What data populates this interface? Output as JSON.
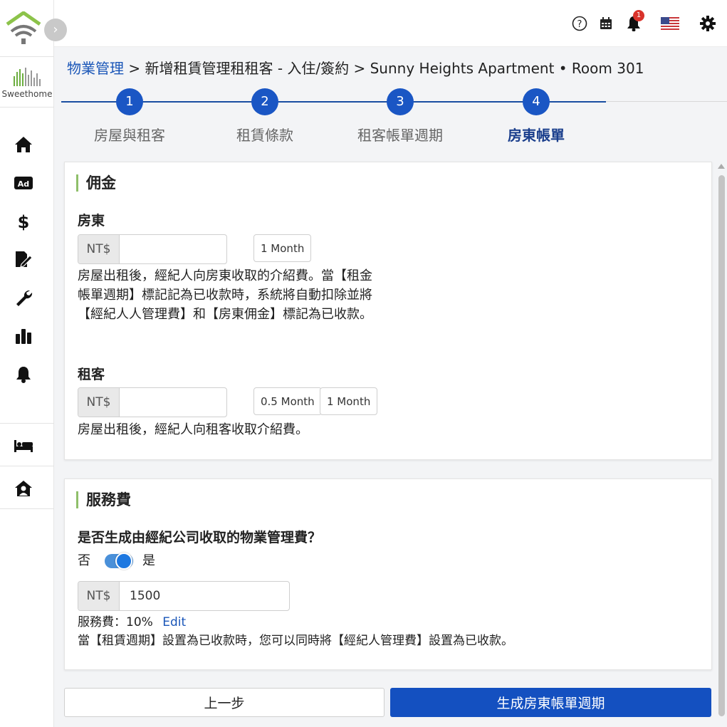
{
  "brand": {
    "name": "Sweethome"
  },
  "topbar": {
    "help_icon": "help-icon",
    "calendar_icon": "calendar-icon",
    "notification_count": "1",
    "language_icon": "us-flag-icon",
    "settings_icon": "gear-icon"
  },
  "sidebar": {
    "items": [
      {
        "icon": "home-icon"
      },
      {
        "icon": "ad-icon"
      },
      {
        "icon": "dollar-icon"
      },
      {
        "icon": "contract-edit-icon"
      },
      {
        "icon": "wrench-icon"
      },
      {
        "icon": "bar-chart-icon"
      },
      {
        "icon": "bell-icon"
      },
      {
        "icon": "bed-icon"
      },
      {
        "icon": "house-user-icon"
      }
    ]
  },
  "breadcrumb": {
    "root": "物業管理",
    "rest": " > 新增租賃管理租租客 - 入住/簽約 > Sunny Heights Apartment • Room 301"
  },
  "steps": [
    {
      "number": "1",
      "label": "房屋與租客"
    },
    {
      "number": "2",
      "label": "租賃條款"
    },
    {
      "number": "3",
      "label": "租客帳單週期"
    },
    {
      "number": "4",
      "label": "房東帳單"
    }
  ],
  "commission": {
    "title": "佣金",
    "landlord": {
      "label": "房東",
      "prefix": "NT$",
      "value": "",
      "chips": [
        "1 Month"
      ],
      "description": "房屋出租後，經紀人向房東收取的介紹費。當【租金帳單週期】標記記為已收款時，系統將自動扣除並將【經紀人人管理費】和【房東佣金】標記為已收款。"
    },
    "tenant": {
      "label": "租客",
      "prefix": "NT$",
      "value": "",
      "chips": [
        "0.5 Month",
        "1 Month"
      ],
      "description": "房屋出租後，經紀人向租客收取介紹費。"
    }
  },
  "service_fee": {
    "title": "服務費",
    "question": "是否生成由經紀公司收取的物業管理費？",
    "toggle_off_label": "否",
    "toggle_on_label": "是",
    "toggle_on": true,
    "prefix": "NT$",
    "value": "1500",
    "rate_text": "服務費：10%",
    "edit_label": "Edit",
    "note": "當【租賃週期】設置為已收款時，您可以同時將【經紀人管理費】設置為已收款。"
  },
  "actions": {
    "prev_label": "上一步",
    "next_label": "生成房東帳單週期"
  },
  "colors": {
    "primary": "#1450c0",
    "link": "#1a56b8",
    "accent_bar": "#8fbf6a",
    "badge": "#d9332b"
  }
}
